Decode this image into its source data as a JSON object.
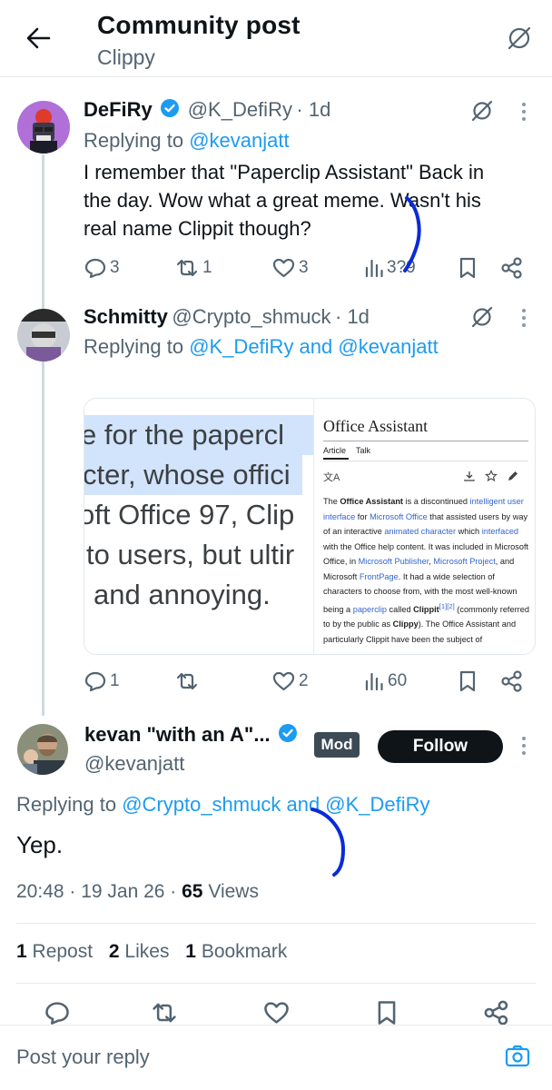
{
  "header": {
    "title": "Community post",
    "subtitle": "Clippy"
  },
  "tweets": [
    {
      "name": "DeFiRy",
      "handle": "@K_DefiRy",
      "time": "· 1d",
      "replying_prefix": "Replying to ",
      "replying_to": "@kevanjatt",
      "lines": [
        "I remember that \"Paperclip Assistant\" Back in",
        "the day.  Wow what a great meme.  Wasn't his",
        "real name Clippit though?"
      ],
      "replies": "3",
      "reposts": "1",
      "likes": "3",
      "views": "3?9"
    },
    {
      "name": "Schmitty",
      "handle": "@Crypto_shmuck",
      "time": "· 1d",
      "replying_prefix": "Replying to ",
      "replying_to": "@K_DefiRy and @kevanjatt",
      "replies": "1",
      "likes": "2",
      "views": "60"
    }
  ],
  "media": {
    "left_lines": [
      "e for the papercl",
      "cter, whose offici",
      "oft Office 97, Clip",
      "to users, but ultir",
      "and annoying."
    ],
    "wiki_title": "Office Assistant",
    "wiki_tab_article": "Article",
    "wiki_tab_talk": "Talk",
    "wiki_paragraph": "The Office Assistant is a discontinued intelligent user interface for Microsoft Office that assisted users by way of an interactive animated character which interfaced with the Office help content. It was included in Microsoft Office, in Microsoft Publisher, Microsoft Project, and Microsoft FrontPage. It had a wide selection of characters to choose from, with the most well-known being a paperclip called Clippit[1][2] (commonly referred to by the public as Clippy). The Office Assistant and particularly Clippit have been the subject of"
  },
  "main_post": {
    "name": "kevan \"with an A\"...",
    "handle": "@kevanjatt",
    "mod_badge": "Mod",
    "follow_label": "Follow",
    "replying_prefix": "Replying to ",
    "replying_handle1": "@Crypto_shmuck",
    "replying_and": " and ",
    "replying_handle2": "@K_DefiRy",
    "text": "Yep.",
    "time": "20:48 · 19 Jan 26 · ",
    "views_count": "65",
    "views_label": " Views",
    "reposts_count": "1",
    "reposts_label": " Repost",
    "likes_count": "2",
    "likes_label": " Likes",
    "bookmarks_count": "1",
    "bookmarks_label": " Bookmark"
  },
  "reply_placeholder": "Post your reply",
  "colors": {
    "accent": "#1d9bf0",
    "muted": "#536471",
    "text": "#0f1419",
    "ink": "#0a2bd6"
  }
}
